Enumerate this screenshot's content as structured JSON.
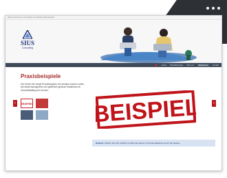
{
  "browser": {
    "url": "https://www.sius-consulting.com/de/praxisbeispiele/"
  },
  "logo": {
    "title": "SIUS",
    "subtitle": "Consulting"
  },
  "nav": {
    "items": [
      "Home",
      "Dienstleistungen",
      "Über uns",
      "Referenzen",
      "Kontakt"
    ],
    "active_index": 3
  },
  "page": {
    "title": "Praxisbeispiele",
    "description": "Hier finden Sie einige Praxisbeispiele, die deutlich machen sollen, wie abwechslungsreich und gefährlich gewisse Situationen im Geschäftsalltag sein können.",
    "thumb_label": "BEISPIEL"
  },
  "stamp": {
    "text": "BEISPIEL"
  },
  "info": {
    "label": "Hinweis:",
    "text": "Klicken Sie sich einfach mit Hilfe des kleinen Vorschau-Beispiels durch die Galerie."
  },
  "arrows": {
    "left": "‹",
    "right": "›"
  },
  "colors": {
    "accent": "#b9161d",
    "nav": "#3f4a59",
    "brand": "#23397a"
  }
}
